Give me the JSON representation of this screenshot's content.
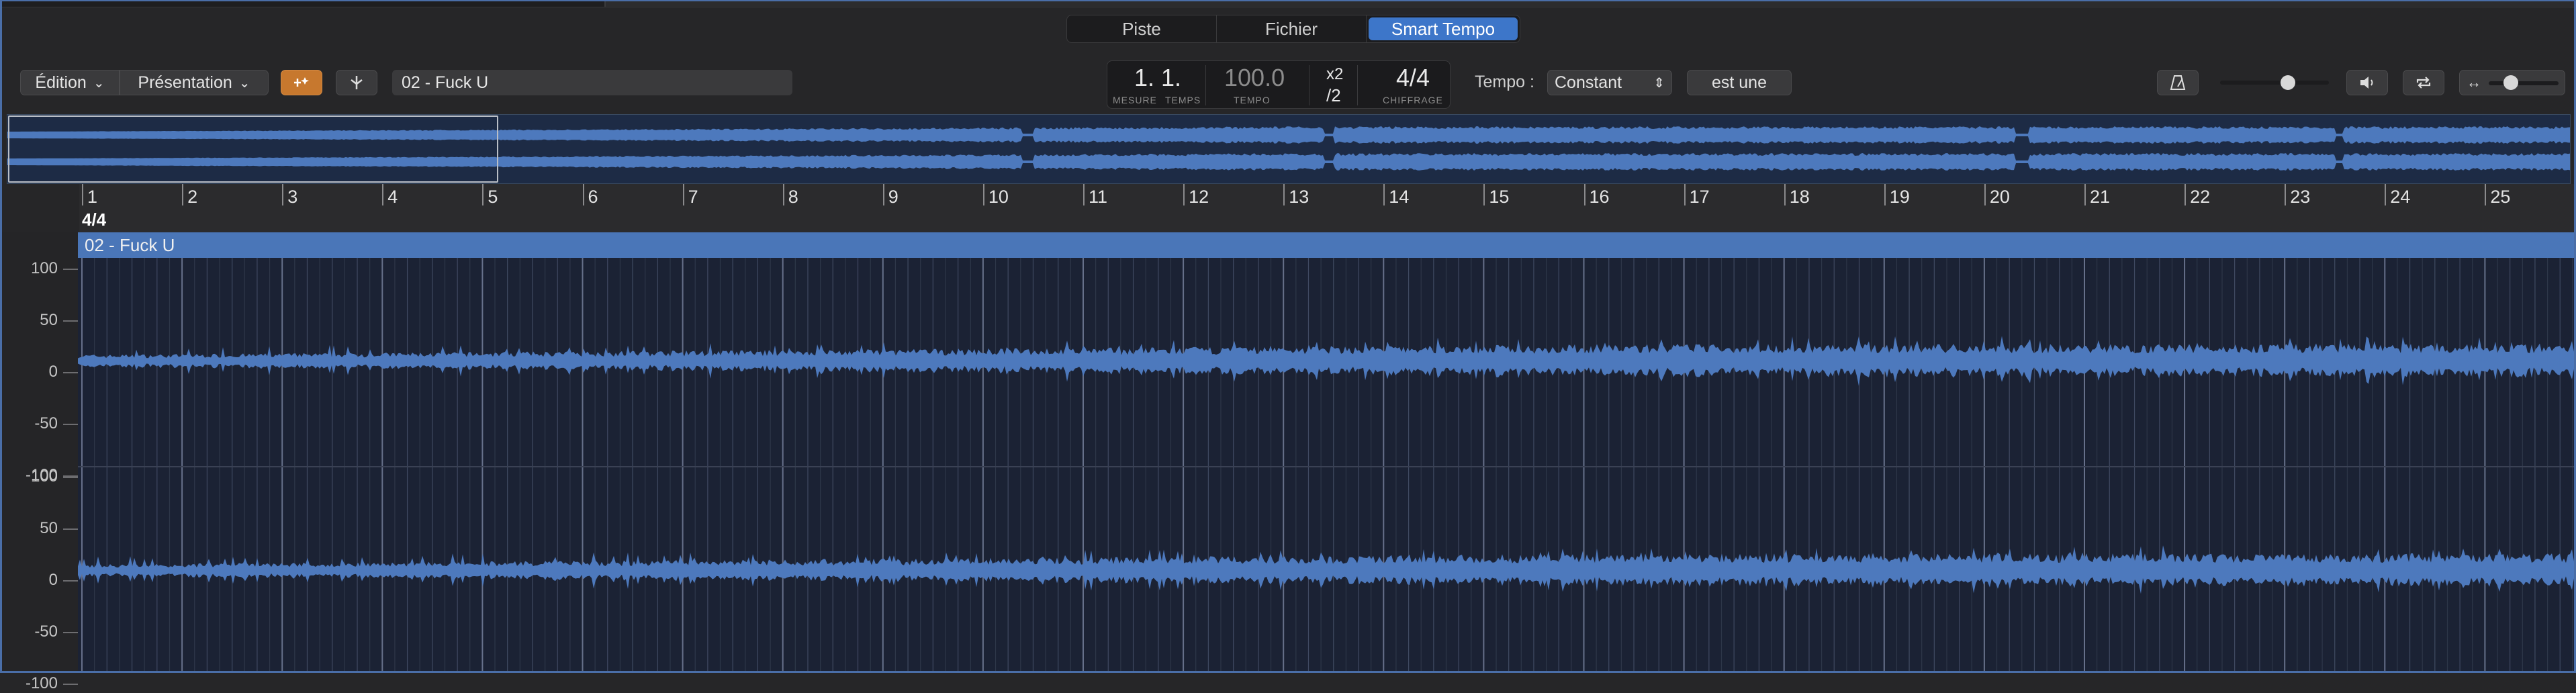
{
  "tabs": [
    {
      "label": "Piste",
      "active": false
    },
    {
      "label": "Fichier",
      "active": false
    },
    {
      "label": "Smart Tempo",
      "active": true
    }
  ],
  "toolbar": {
    "edit_menu": "Édition",
    "view_menu": "Présentation",
    "flex_icon": "flex-sparkle-icon",
    "catch_icon": "catch-playhead-icon",
    "track_name": "02 - Fuck U",
    "tempo_label": "Tempo :",
    "tempo_mode": "Constant",
    "tempo_action": "est une",
    "metronome_icon": "metronome-icon",
    "speaker_icon": "speaker-icon",
    "loop_icon": "cycle-icon",
    "zoom_icon": "horizontal-zoom-icon"
  },
  "lcd": {
    "position": "1. 1.",
    "position_label_1": "MESURE",
    "position_label_2": "TEMPS",
    "tempo": "100.0",
    "tempo_label": "TEMPO",
    "mult": "x2",
    "div": "/2",
    "signature": "4/4",
    "signature_label": "CHIFFRAGE"
  },
  "ruler": {
    "bars": [
      "1",
      "2",
      "3",
      "4",
      "5",
      "6",
      "7",
      "8",
      "9",
      "10",
      "11",
      "12",
      "13",
      "14",
      "15",
      "16",
      "17",
      "18",
      "19",
      "20",
      "21",
      "22",
      "23",
      "24",
      "25"
    ],
    "time_signature": "4/4"
  },
  "region": {
    "name": "02 - Fuck U"
  },
  "scale": {
    "top": [
      "100",
      "50",
      "0",
      "-50",
      "-100"
    ],
    "bottom": [
      "100",
      "50",
      "0",
      "-50",
      "-100"
    ]
  },
  "colors": {
    "accent": "#3d76c9",
    "waveform": "#4d79bd",
    "region": "#4a76b8",
    "flex_button": "#c7782e"
  }
}
